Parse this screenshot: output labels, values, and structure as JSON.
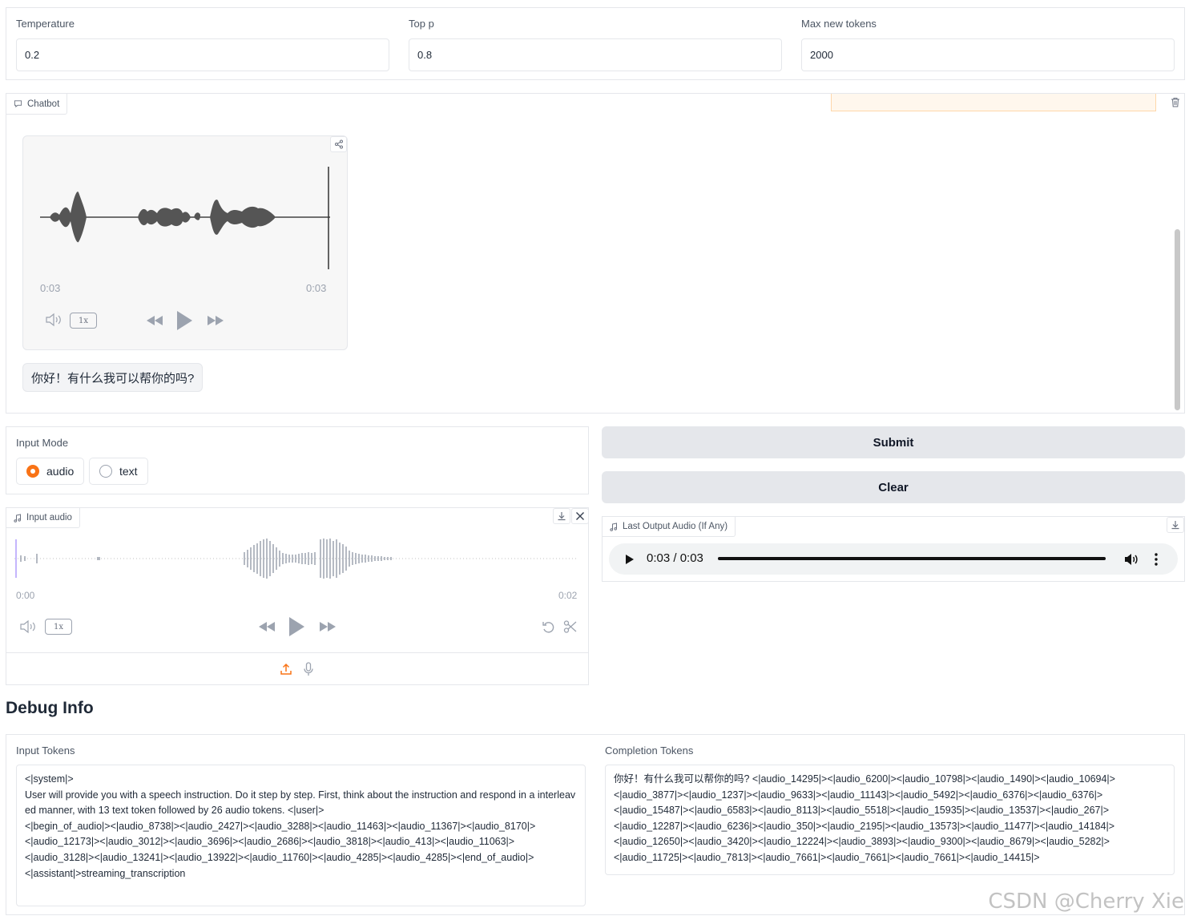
{
  "params": {
    "temperature": {
      "label": "Temperature",
      "value": "0.2"
    },
    "top_p": {
      "label": "Top p",
      "value": "0.8"
    },
    "max_new_tokens": {
      "label": "Max new tokens",
      "value": "2000"
    }
  },
  "chatbot": {
    "label": "Chatbot",
    "audio_message": {
      "time_current": "0:03",
      "time_total": "0:03",
      "speed": "1x"
    },
    "text_message": "你好！有什么我可以帮你的吗?"
  },
  "input_mode": {
    "label": "Input Mode",
    "options": [
      {
        "label": "audio",
        "selected": true
      },
      {
        "label": "text",
        "selected": false
      }
    ]
  },
  "buttons": {
    "submit": "Submit",
    "clear": "Clear"
  },
  "input_audio": {
    "label": "Input audio",
    "time_start": "0:00",
    "time_end": "0:02",
    "speed": "1x"
  },
  "last_output_audio": {
    "label": "Last Output Audio (If Any)",
    "time_display": "0:03 / 0:03",
    "progress": 1.0
  },
  "debug": {
    "heading": "Debug Info",
    "input_tokens": {
      "label": "Input Tokens",
      "value": "<|system|>\nUser will provide you with a speech instruction. Do it step by step. First, think about the instruction and respond in a interleaved manner, with 13 text token followed by 26 audio tokens. <|user|>\n<|begin_of_audio|><|audio_8738|><|audio_2427|><|audio_3288|><|audio_11463|><|audio_11367|><|audio_8170|>\n<|audio_12173|><|audio_3012|><|audio_3696|><|audio_2686|><|audio_3818|><|audio_413|><|audio_11063|>\n<|audio_3128|><|audio_13241|><|audio_13922|><|audio_11760|><|audio_4285|><|audio_4285|><|end_of_audio|>\n<|assistant|>streaming_transcription"
    },
    "completion_tokens": {
      "label": "Completion Tokens",
      "value": "你好！有什么我可以帮你的吗? <|audio_14295|><|audio_6200|><|audio_10798|><|audio_1490|><|audio_10694|>\n<|audio_3877|><|audio_1237|><|audio_9633|><|audio_11143|><|audio_5492|><|audio_6376|><|audio_6376|>\n<|audio_15487|><|audio_6583|><|audio_8113|><|audio_5518|><|audio_15935|><|audio_13537|><|audio_267|>\n<|audio_12287|><|audio_6236|><|audio_350|><|audio_2195|><|audio_13573|><|audio_11477|><|audio_14184|>\n<|audio_12650|><|audio_3420|><|audio_12224|><|audio_3893|><|audio_9300|><|audio_8679|><|audio_5282|>\n<|audio_11725|><|audio_7813|><|audio_7661|><|audio_7661|><|audio_7661|><|audio_14415|>"
    }
  },
  "watermark": "CSDN @Cherry Xie"
}
